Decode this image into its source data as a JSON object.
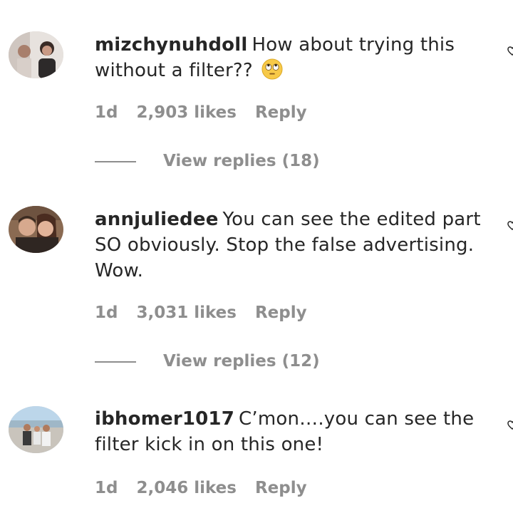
{
  "comments": [
    {
      "username": "mizchynuhdoll",
      "text": "How about trying this without a filter??",
      "emoji": "🙄",
      "time": "1d",
      "likes": "2,903 likes",
      "reply": "Reply",
      "view_replies": "View replies (18)"
    },
    {
      "username": "annjuliedee",
      "text": "You can see the edited part SO obviously. Stop the false advertising. Wow.",
      "time": "1d",
      "likes": "3,031 likes",
      "reply": "Reply",
      "view_replies": "View replies (12)"
    },
    {
      "username": "ibhomer1017",
      "text": "C’mon….you can see the filter kick in on this one!",
      "time": "1d",
      "likes": "2,046 likes",
      "reply": "Reply"
    }
  ],
  "icons": {
    "avatar": "user-avatar",
    "like": "heart-icon",
    "emoji": "face-with-rolling-eyes-emoji"
  }
}
